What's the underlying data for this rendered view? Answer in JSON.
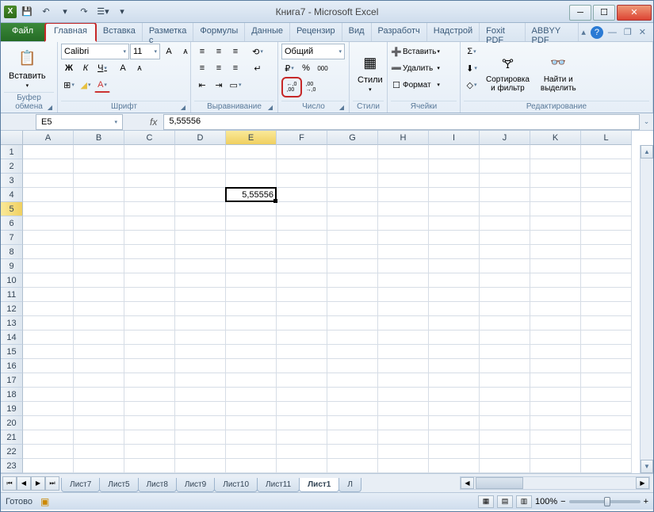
{
  "title": "Книга7  -  Microsoft Excel",
  "qat": {
    "save": "💾",
    "undo": "↶",
    "redo": "↷",
    "more": "▾"
  },
  "win": {
    "min": "─",
    "max": "☐",
    "close": "✕"
  },
  "tabs": {
    "file": "Файл",
    "items": [
      "Главная",
      "Вставка",
      "Разметка с",
      "Формулы",
      "Данные",
      "Рецензир",
      "Вид",
      "Разработч",
      "Надстрой",
      "Foxit PDF",
      "ABBYY PDF"
    ],
    "active": 0
  },
  "subwin": {
    "up": "▴",
    "help": "?",
    "min2": "—",
    "restore": "❐",
    "close2": "✕"
  },
  "ribbon": {
    "clipboard": {
      "label": "Буфер обмена",
      "paste": "Вставить",
      "paste_icon": "📋"
    },
    "font": {
      "label": "Шрифт",
      "name": "Calibri",
      "size": "11",
      "bold": "Ж",
      "italic": "К",
      "underline": "Ч",
      "grow": "A",
      "shrink": "ᴀ",
      "border": "⊞",
      "fill": "◢",
      "color": "A"
    },
    "align": {
      "label": "Выравнивание",
      "top": "⬆",
      "mid": "≡",
      "bot": "⬇",
      "left": "≡",
      "center": "≡",
      "right": "≡",
      "indentL": "⇤",
      "indentR": "⇥",
      "orient": "⟲",
      "wrap": "↵",
      "merge": "▭"
    },
    "number": {
      "label": "Число",
      "format": "Общий",
      "currency": "₽",
      "percent": "%",
      "comma": "000",
      "inc": "←,0\n,00",
      "dec": ",00\n→,0"
    },
    "styles": {
      "label": "Стили",
      "btn": "Стили"
    },
    "cells": {
      "label": "Ячейки",
      "insert": "Вставить",
      "delete": "Удалить",
      "format": "Формат"
    },
    "editing": {
      "label": "Редактирование",
      "sum": "Σ",
      "fill": "⬇",
      "clear": "◇",
      "sort": "Сортировка\nи фильтр",
      "find": "Найти и\nвыделить"
    }
  },
  "namebox": "E5",
  "fx": "fx",
  "formula": "5,55556",
  "cols": [
    "A",
    "B",
    "C",
    "D",
    "E",
    "F",
    "G",
    "H",
    "I",
    "J",
    "K",
    "L"
  ],
  "rows": [
    "1",
    "2",
    "3",
    "4",
    "5",
    "6",
    "7",
    "8",
    "9",
    "10",
    "11",
    "12",
    "13",
    "14",
    "15",
    "16",
    "17",
    "18",
    "19",
    "20",
    "21",
    "22",
    "23"
  ],
  "active_cell": {
    "col": 4,
    "row": 4,
    "value": "5,55556"
  },
  "sheets": {
    "nav": {
      "first": "⏮",
      "prev": "◀",
      "next": "▶",
      "last": "⏭"
    },
    "tabs": [
      "Лист7",
      "Лист5",
      "Лист8",
      "Лист9",
      "Лист10",
      "Лист11",
      "Лист1",
      "Л"
    ],
    "active": 6
  },
  "status": {
    "ready": "Готово",
    "zoom": "100%",
    "minus": "−",
    "plus": "+"
  }
}
